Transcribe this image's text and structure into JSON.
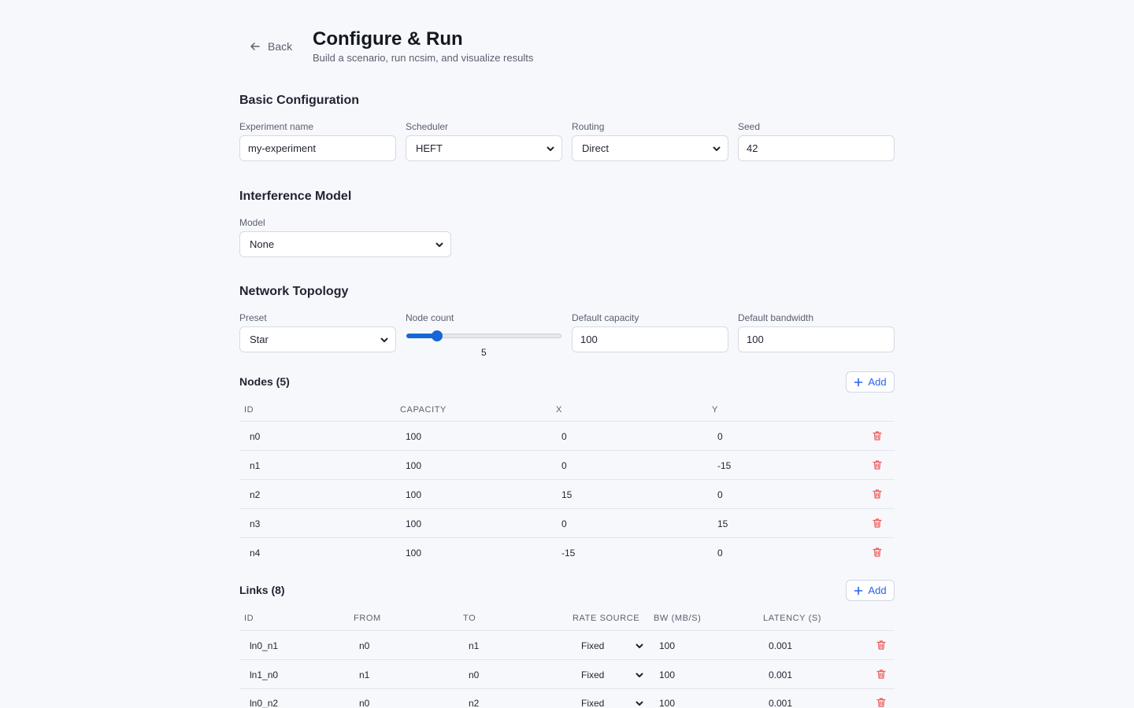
{
  "header": {
    "back_label": "Back",
    "title": "Configure & Run",
    "subtitle": "Build a scenario, run ncsim, and visualize results"
  },
  "basic": {
    "title": "Basic Configuration",
    "experiment_label": "Experiment name",
    "experiment_value": "my-experiment",
    "scheduler_label": "Scheduler",
    "scheduler_value": "HEFT",
    "routing_label": "Routing",
    "routing_value": "Direct",
    "seed_label": "Seed",
    "seed_value": "42"
  },
  "interference": {
    "title": "Interference Model",
    "model_label": "Model",
    "model_value": "None"
  },
  "topology": {
    "title": "Network Topology",
    "preset_label": "Preset",
    "preset_value": "Star",
    "node_count_label": "Node count",
    "node_count_value": "5",
    "node_count_fraction": 0.2,
    "capacity_label": "Default capacity",
    "capacity_value": "100",
    "bandwidth_label": "Default bandwidth",
    "bandwidth_value": "100"
  },
  "nodes": {
    "title": "Nodes (5)",
    "add_label": "Add",
    "headers": [
      "ID",
      "CAPACITY",
      "X",
      "Y"
    ],
    "rows": [
      {
        "id": "n0",
        "capacity": "100",
        "x": "0",
        "y": "0"
      },
      {
        "id": "n1",
        "capacity": "100",
        "x": "0",
        "y": "-15"
      },
      {
        "id": "n2",
        "capacity": "100",
        "x": "15",
        "y": "0"
      },
      {
        "id": "n3",
        "capacity": "100",
        "x": "0",
        "y": "15"
      },
      {
        "id": "n4",
        "capacity": "100",
        "x": "-15",
        "y": "0"
      }
    ]
  },
  "links": {
    "title": "Links (8)",
    "add_label": "Add",
    "headers": [
      "ID",
      "FROM",
      "TO",
      "RATE SOURCE",
      "BW (MB/S)",
      "LATENCY (S)"
    ],
    "rows": [
      {
        "id": "ln0_n1",
        "from": "n0",
        "to": "n1",
        "rate": "Fixed",
        "bw": "100",
        "latency": "0.001"
      },
      {
        "id": "ln1_n0",
        "from": "n1",
        "to": "n0",
        "rate": "Fixed",
        "bw": "100",
        "latency": "0.001"
      },
      {
        "id": "ln0_n2",
        "from": "n0",
        "to": "n2",
        "rate": "Fixed",
        "bw": "100",
        "latency": "0.001"
      }
    ]
  },
  "colors": {
    "accent": "#1766d6",
    "danger": "#ef5b5b",
    "background": "#f7f8fc"
  }
}
